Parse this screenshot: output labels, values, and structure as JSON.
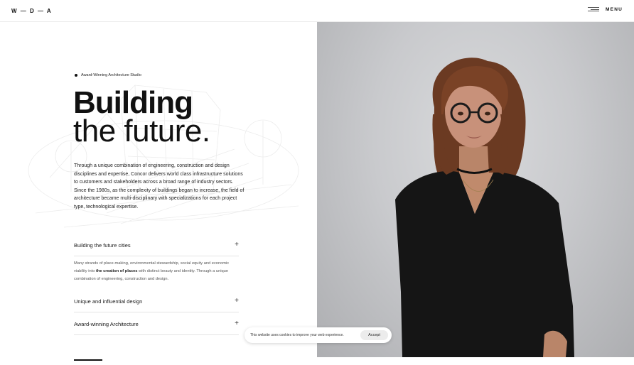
{
  "header": {
    "logo": "W — D — A",
    "menu_label": "MENU"
  },
  "hero": {
    "eyebrow": "Award-Winning Architecture Studio",
    "title_line1": "Building",
    "title_line2": "the future.",
    "intro": "Through a unique combination of engineering, construction and design disciplines and expertise, Concor delivers world class infrastructure solutions to customers and stakeholders across a broad range of industry sectors. Since the 1980s, as the complexity of buildings began to increase, the field of architecture became multi-disciplinary with specializations for each project type, technological expertise."
  },
  "accordion": [
    {
      "label": "Building the future cities",
      "body_before": "Many strands of place-making, environmental stewardship, social equity and economic viability into ",
      "body_bold": "the creation of places",
      "body_after": " with distinct beauty and identity. Through a unique combination of engineering, construction and design."
    },
    {
      "label": "Unique and influential design"
    },
    {
      "label": "Award-winning Architecture"
    }
  ],
  "icons": {
    "expand": "+"
  },
  "cookie": {
    "text": "This website uses cookies to improve your web experience.",
    "accept_label": "Accept"
  },
  "colors": {
    "text": "#111111",
    "photo_background": "#c9cacd",
    "divider": "#e4e4e4"
  }
}
